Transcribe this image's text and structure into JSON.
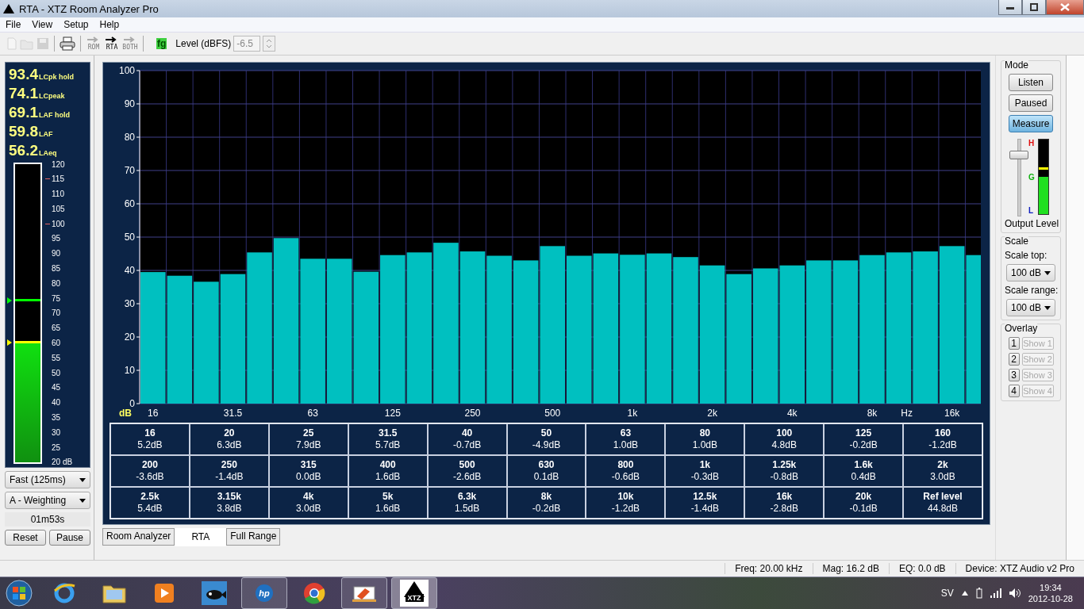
{
  "window": {
    "title": "RTA - XTZ Room Analyzer Pro"
  },
  "menu": [
    "File",
    "View",
    "Setup",
    "Help"
  ],
  "toolbar": {
    "items": [
      {
        "kind": "new",
        "disabled": true
      },
      {
        "kind": "open",
        "disabled": true
      },
      {
        "kind": "save",
        "disabled": true
      },
      {
        "kind": "sep"
      },
      {
        "kind": "print",
        "disabled": false
      },
      {
        "kind": "sep"
      },
      {
        "kind": "arrow",
        "label": "ROM",
        "disabled": true
      },
      {
        "kind": "arrow",
        "label": "RTA",
        "disabled": false
      },
      {
        "kind": "arrow",
        "label": "BOTH",
        "disabled": true
      }
    ],
    "fg_label": "fg",
    "level_label": "Level (dBFS)",
    "level_value": "-6.5",
    "level_disabled": true
  },
  "left_panel": {
    "readings": [
      {
        "value": "93.4",
        "label": "LCpk hold"
      },
      {
        "value": "74.1",
        "label": "LCpeak"
      },
      {
        "value": "69.1",
        "label": "LAF hold"
      },
      {
        "value": "59.8",
        "label": "LAF"
      },
      {
        "value": "56.2",
        "label": "LAeq"
      }
    ],
    "meter": {
      "level": 0.398,
      "markers": [
        {
          "level": 0.541,
          "color": "#00ff00"
        },
        {
          "level": 0.398,
          "color": "#ffff00"
        }
      ],
      "ticks": [
        {
          "label": "120",
          "marked": false
        },
        {
          "label": "115",
          "marked": true
        },
        {
          "label": "110",
          "marked": false
        },
        {
          "label": "105",
          "marked": false
        },
        {
          "label": "100",
          "marked": true
        },
        {
          "label": "95",
          "marked": false
        },
        {
          "label": "90",
          "marked": false
        },
        {
          "label": "85",
          "marked": false
        },
        {
          "label": "80",
          "marked": false
        },
        {
          "label": "75",
          "marked": false
        },
        {
          "label": "70",
          "marked": false
        },
        {
          "label": "65",
          "marked": false
        },
        {
          "label": "60",
          "marked": false
        },
        {
          "label": "55",
          "marked": false
        },
        {
          "label": "50",
          "marked": false
        },
        {
          "label": "45",
          "marked": false
        },
        {
          "label": "40",
          "marked": false
        },
        {
          "label": "35",
          "marked": false
        },
        {
          "label": "30",
          "marked": false
        },
        {
          "label": "25",
          "marked": false
        },
        {
          "label": "20 dB",
          "marked": false
        }
      ]
    },
    "dropdowns": [
      "Fast (125ms)",
      "A - Weighting"
    ],
    "timer": "01m53s",
    "buttons": [
      "Reset",
      "Pause"
    ]
  },
  "chart": {
    "chart_data": {
      "type": "bar",
      "xlabel": "Hz",
      "ylabel": "dB",
      "ylim": [
        0,
        100
      ],
      "yticks": [
        0,
        10,
        20,
        30,
        40,
        50,
        60,
        70,
        80,
        90,
        100
      ],
      "grid": true,
      "categories": [
        "16",
        null,
        null,
        "31.5",
        null,
        null,
        "63",
        null,
        null,
        "125",
        null,
        null,
        "250",
        null,
        null,
        "500",
        null,
        null,
        "1k",
        null,
        null,
        "2k",
        null,
        null,
        "4k",
        null,
        null,
        "8k",
        null,
        null,
        "16k",
        null
      ],
      "series": [
        {
          "color": "#00c0c0",
          "values": [
            39.5,
            38.4,
            36.6,
            38.9,
            45.4,
            49.7,
            43.5,
            43.5,
            39.6,
            44.6,
            45.4,
            48.3,
            45.7,
            44.4,
            43.0,
            47.3,
            44.4,
            45.1,
            44.7,
            45.1,
            44.0,
            41.5,
            38.9,
            40.6,
            41.5,
            43.0,
            43.0,
            44.6,
            45.4,
            45.7,
            47.3,
            44.6
          ]
        }
      ]
    }
  },
  "table": {
    "cells": [
      {
        "freq": "16",
        "value": "5.2dB"
      },
      {
        "freq": "20",
        "value": "6.3dB"
      },
      {
        "freq": "25",
        "value": "7.9dB"
      },
      {
        "freq": "31.5",
        "value": "5.7dB"
      },
      {
        "freq": "40",
        "value": "-0.7dB"
      },
      {
        "freq": "50",
        "value": "-4.9dB"
      },
      {
        "freq": "63",
        "value": "1.0dB"
      },
      {
        "freq": "80",
        "value": "1.0dB"
      },
      {
        "freq": "100",
        "value": "4.8dB"
      },
      {
        "freq": "125",
        "value": "-0.2dB"
      },
      {
        "freq": "160",
        "value": "-1.2dB"
      },
      {
        "freq": "200",
        "value": "-3.6dB"
      },
      {
        "freq": "250",
        "value": "-1.4dB"
      },
      {
        "freq": "315",
        "value": "0.0dB"
      },
      {
        "freq": "400",
        "value": "1.6dB"
      },
      {
        "freq": "500",
        "value": "-2.6dB"
      },
      {
        "freq": "630",
        "value": "0.1dB"
      },
      {
        "freq": "800",
        "value": "-0.6dB"
      },
      {
        "freq": "1k",
        "value": "-0.3dB"
      },
      {
        "freq": "1.25k",
        "value": "-0.8dB"
      },
      {
        "freq": "1.6k",
        "value": "0.4dB"
      },
      {
        "freq": "2k",
        "value": "3.0dB"
      },
      {
        "freq": "2.5k",
        "value": "5.4dB"
      },
      {
        "freq": "3.15k",
        "value": "3.8dB"
      },
      {
        "freq": "4k",
        "value": "3.0dB"
      },
      {
        "freq": "5k",
        "value": "1.6dB"
      },
      {
        "freq": "6.3k",
        "value": "1.5dB"
      },
      {
        "freq": "8k",
        "value": "-0.2dB"
      },
      {
        "freq": "10k",
        "value": "-1.2dB"
      },
      {
        "freq": "12.5k",
        "value": "-1.4dB"
      },
      {
        "freq": "16k",
        "value": "-2.8dB"
      },
      {
        "freq": "20k",
        "value": "-0.1dB"
      },
      {
        "freq": "Ref level",
        "value": "44.8dB"
      }
    ]
  },
  "tabs": [
    {
      "label": "Room Analyzer",
      "selected": false
    },
    {
      "label": "RTA",
      "selected": true
    },
    {
      "label": "Full Range",
      "selected": false
    }
  ],
  "right_panel": {
    "mode_title": "Mode",
    "modes": [
      {
        "label": "Listen",
        "selected": false
      },
      {
        "label": "Paused",
        "selected": false
      },
      {
        "label": "Measure",
        "selected": true
      }
    ],
    "output_slider": {
      "level": 0.78
    },
    "output_meter": {
      "level": 0.5,
      "marker": {
        "level": 0.6
      },
      "labels": [
        {
          "text": "H",
          "color": "#e01010"
        },
        {
          "text": "G",
          "color": "#10b010"
        },
        {
          "text": "L",
          "color": "#1020c0"
        }
      ]
    },
    "output_label": "Output Level",
    "scale_title": "Scale",
    "scale_top_label": "Scale top:",
    "scale_top": "100 dB",
    "scale_range_label": "Scale range:",
    "scale_range": "100 dB",
    "overlay_title": "Overlay",
    "overlays": [
      {
        "number": "1",
        "label": "Show 1",
        "disabled": true
      },
      {
        "number": "2",
        "label": "Show 2",
        "disabled": true
      },
      {
        "number": "3",
        "label": "Show 3",
        "disabled": true
      },
      {
        "number": "4",
        "label": "Show 4",
        "disabled": true
      }
    ]
  },
  "status_bar": [
    "Freq: 20.00 kHz",
    "Mag: 16.2 dB",
    "EQ: 0.0 dB",
    "Device: XTZ Audio v2 Pro"
  ],
  "taskbar": {
    "items": [
      {
        "kind": "browser",
        "open": false,
        "selected": false
      },
      {
        "kind": "folder",
        "open": false,
        "selected": false
      },
      {
        "kind": "media",
        "open": false,
        "selected": false
      },
      {
        "kind": "fish",
        "open": false,
        "selected": false
      },
      {
        "kind": "hp",
        "label": "hp",
        "open": true,
        "selected": false
      },
      {
        "kind": "chrome",
        "open": false,
        "selected": false
      },
      {
        "kind": "paint",
        "open": true,
        "selected": false
      },
      {
        "kind": "xtz",
        "label": "XTZ",
        "open": true,
        "selected": true
      }
    ],
    "language": "SV",
    "time": "19:34",
    "date": "2012-10-28"
  }
}
